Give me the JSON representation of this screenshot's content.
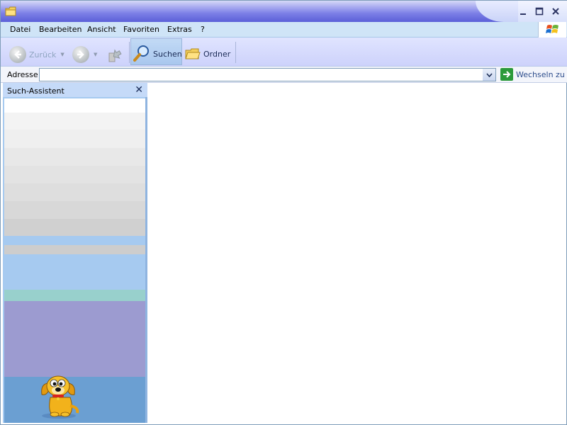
{
  "window": {
    "title_icon": "folder-icon",
    "controls": [
      "minimize-icon",
      "maximize-icon",
      "close-icon"
    ]
  },
  "menubar": {
    "items": [
      {
        "label": "Datei",
        "accel": "D"
      },
      {
        "label": "Bearbeiten",
        "accel": "B"
      },
      {
        "label": "Ansicht",
        "accel": "A"
      },
      {
        "label": "Favoriten",
        "accel": "F"
      },
      {
        "label": "Extras",
        "accel": "E"
      },
      {
        "label": "?",
        "accel": "?"
      }
    ]
  },
  "toolbar": {
    "back_label": "Zurück",
    "search_label": "Suchen",
    "folders_label": "Ordner"
  },
  "address": {
    "label": "Adresse",
    "value": "",
    "go_label": "Wechseln zu"
  },
  "search_pane": {
    "title": "Such-Assistent",
    "close_icon": "close-icon",
    "assistant_icon": "search-dog-icon"
  },
  "colors": {
    "menubar_bg": "#cfe4f7",
    "toolbar_bg": "#cdd2fb",
    "pane_bg": "#a6caf0",
    "go_green": "#2c9a3a"
  }
}
